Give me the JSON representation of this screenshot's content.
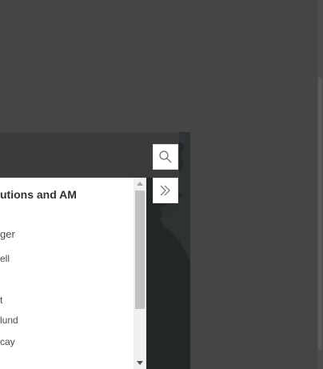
{
  "panel": {
    "title": "utions and AM",
    "lines": [
      {
        "text": "ger"
      },
      {
        "text": "ell"
      },
      {
        "text": "t"
      },
      {
        "text": "lund"
      },
      {
        "text": "cay"
      }
    ]
  },
  "icons": {
    "search": "search-icon",
    "expand": "double-chevron-right-icon"
  },
  "colors": {
    "background": "#454545",
    "map": "#232728",
    "panel": "#ffffff",
    "panel_header": "#3a3c3c",
    "scroll_thumb": "#c1c1c1"
  }
}
